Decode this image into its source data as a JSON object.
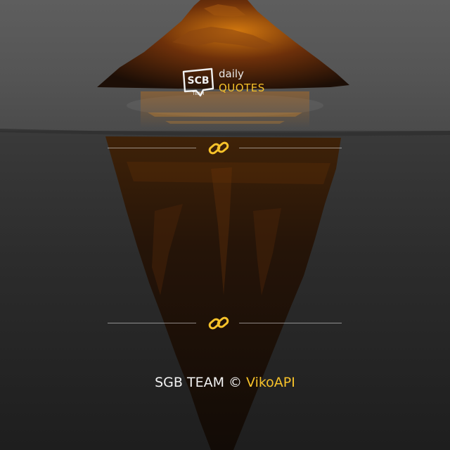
{
  "brand": {
    "badge_text": "SCB",
    "badge_subtext": "TEAM",
    "daily_label": "daily",
    "quotes_label": "QUOTES"
  },
  "footer": {
    "team_label": "SGB TEAM",
    "copyright_symbol": "©",
    "author_label": "VikoAPI"
  },
  "icons": {
    "divider_icon": "link-icon"
  },
  "colors": {
    "accent": "#f7c22a",
    "text": "#f2f2f2",
    "water_surface": "#4b4b4b",
    "deep_water": "#1e1e1e",
    "lava": "#b35a0c"
  }
}
